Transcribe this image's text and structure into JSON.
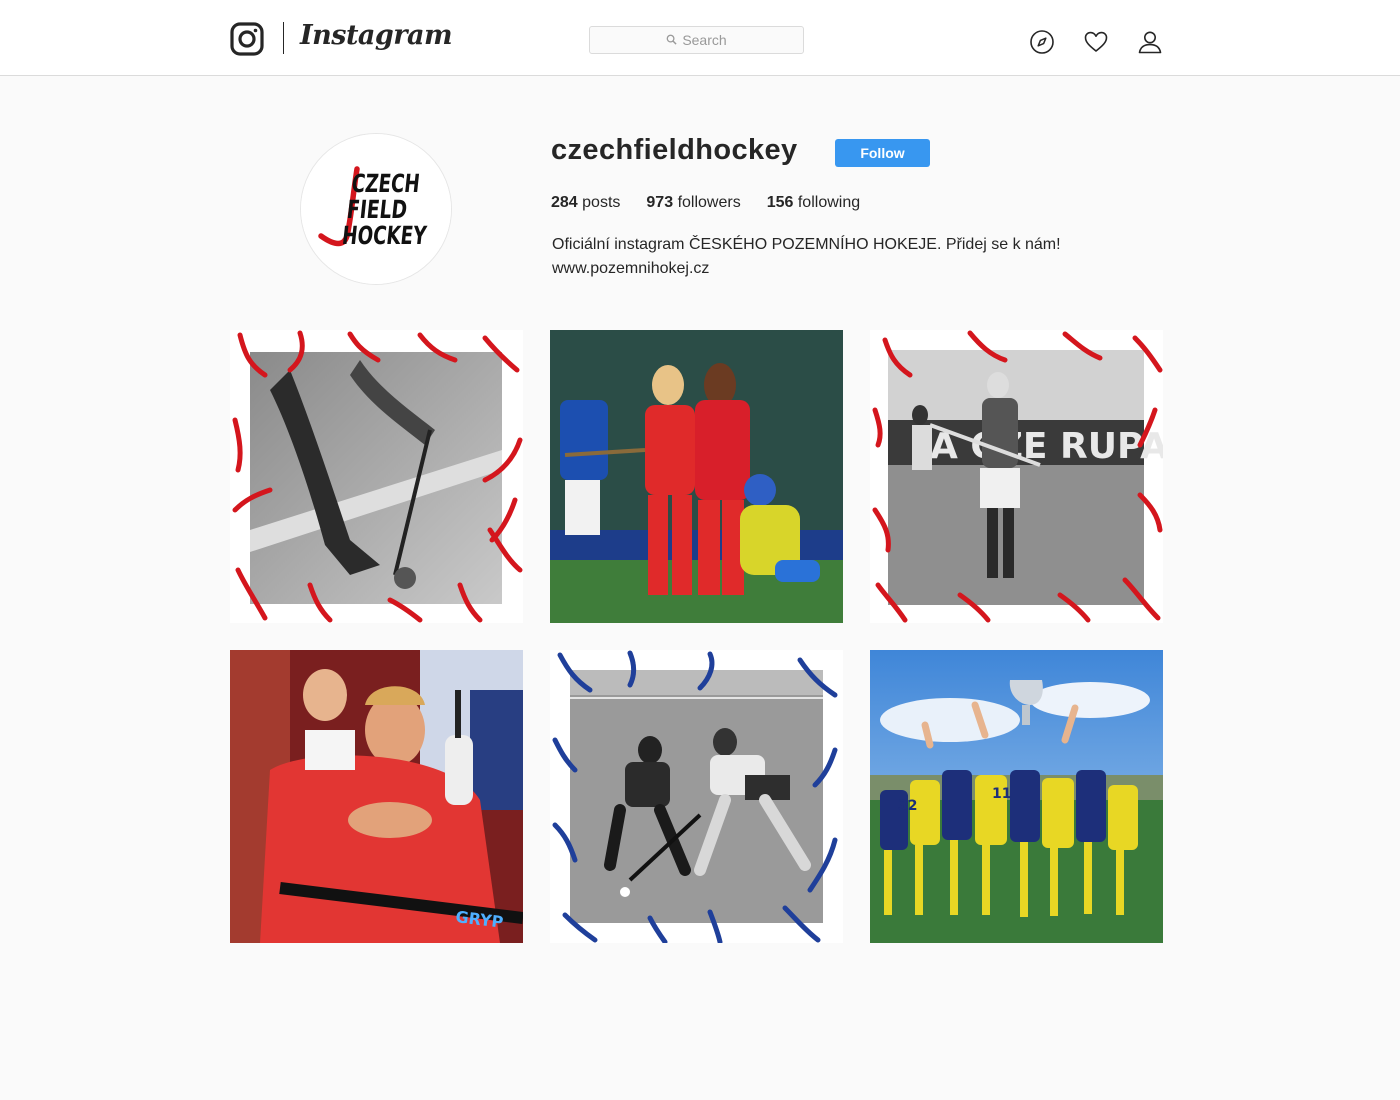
{
  "header": {
    "logo_icon": "instagram-camera-icon",
    "wordmark": "Instagram",
    "search": {
      "placeholder": "Search",
      "icon": "search-icon"
    },
    "nav_icons": [
      "explore-compass-icon",
      "activity-heart-icon",
      "profile-person-icon"
    ]
  },
  "profile": {
    "username": "czechfieldhockey",
    "follow_label": "Follow",
    "avatar_text": [
      "CZECH",
      "FIELD",
      "HOCKEY"
    ],
    "stats": [
      {
        "count": "284",
        "label": "posts"
      },
      {
        "count": "973",
        "label": "followers"
      },
      {
        "count": "156",
        "label": "following"
      }
    ],
    "bio": "Oficiální instagram ČESKÉHO POZEMNÍHO HOKEJE. Přidej se k nám!",
    "website": "www.pozemnihokej.cz"
  },
  "posts": [
    {
      "id": "post-1",
      "style": "grayscale photo with red brush-stroke frame"
    },
    {
      "id": "post-2",
      "style": "color photo, players in red celebrating"
    },
    {
      "id": "post-3",
      "style": "grayscale photo with red brush-stroke frame"
    },
    {
      "id": "post-4",
      "style": "color photo, player in red on bench"
    },
    {
      "id": "post-5",
      "style": "grayscale photo with blue brush-stroke frame"
    },
    {
      "id": "post-6",
      "style": "color photo, team in yellow lifting trophy"
    }
  ],
  "colors": {
    "follow_button": "#3897f0",
    "brand_red": "#d4161d",
    "brand_blue": "#1f3f9a",
    "background": "#fafafa",
    "header_border": "#dbdbdb"
  }
}
